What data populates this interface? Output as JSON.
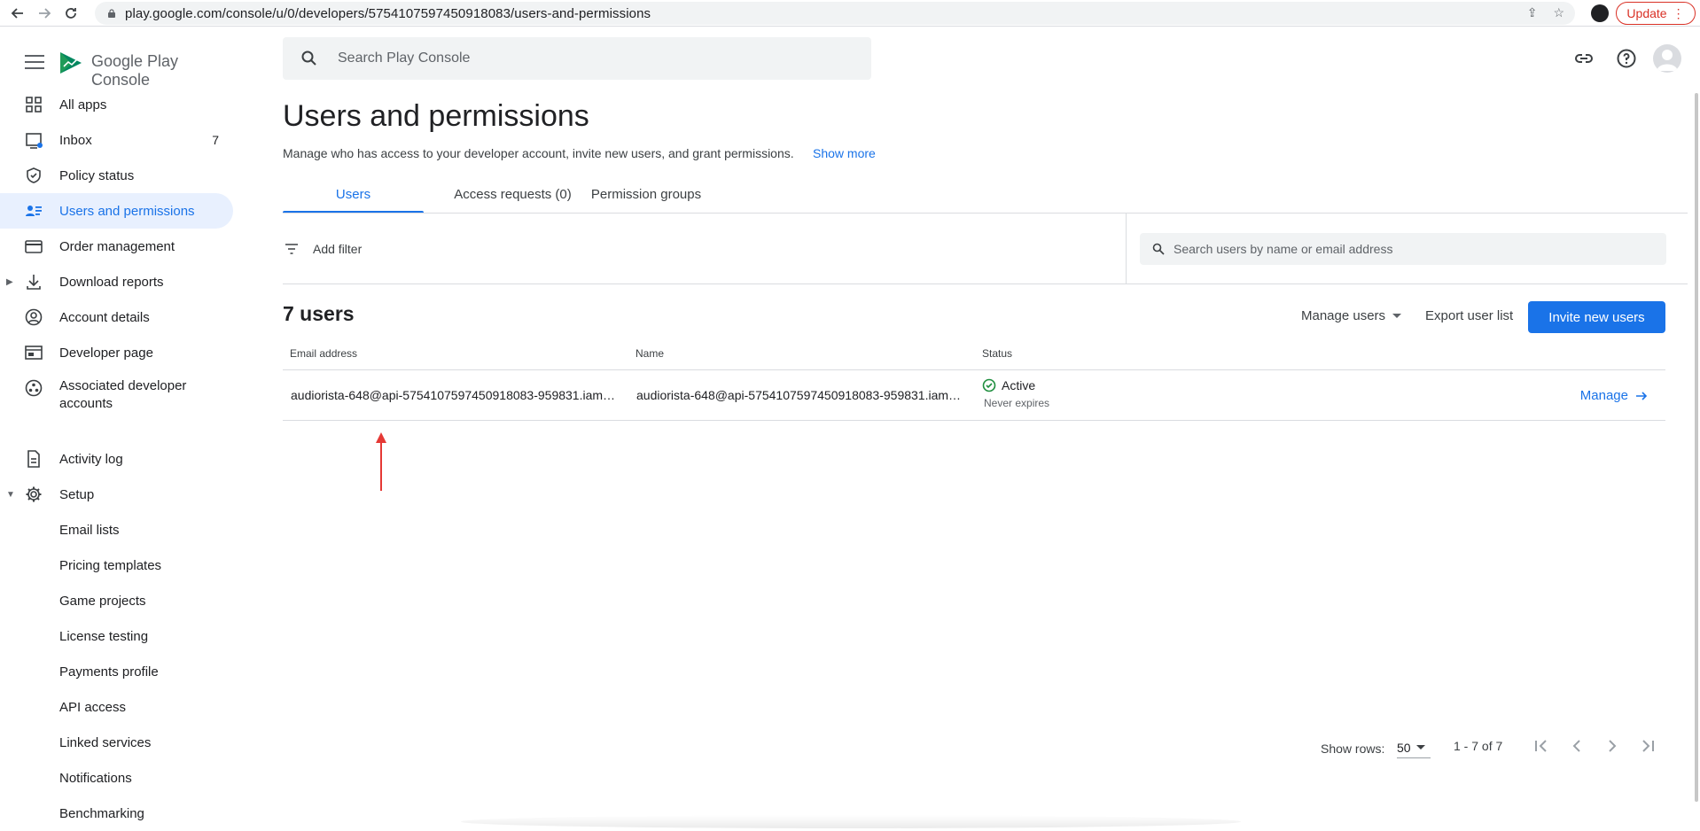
{
  "browser": {
    "url": "play.google.com/console/u/0/developers/5754107597450918083/users-and-permissions",
    "update_label": "Update"
  },
  "app": {
    "logo_text": "Google Play Console",
    "search_placeholder": "Search Play Console"
  },
  "sidebar": {
    "items": [
      {
        "label": "All apps",
        "icon": "grid-icon"
      },
      {
        "label": "Inbox",
        "icon": "inbox-icon",
        "badge": "7"
      },
      {
        "label": "Policy status",
        "icon": "shield-icon"
      },
      {
        "label": "Users and permissions",
        "icon": "people-list-icon"
      },
      {
        "label": "Order management",
        "icon": "credit-card-icon"
      },
      {
        "label": "Download reports",
        "icon": "download-icon"
      },
      {
        "label": "Account details",
        "icon": "account-circle-icon"
      },
      {
        "label": "Developer page",
        "icon": "web-page-icon"
      },
      {
        "label": "Associated developer",
        "label2": "accounts",
        "icon": "associated-icon"
      },
      {
        "label": "Activity log",
        "icon": "document-icon"
      },
      {
        "label": "Setup",
        "icon": "gear-icon"
      }
    ],
    "setup_items": [
      "Email lists",
      "Pricing templates",
      "Game projects",
      "License testing",
      "Payments profile",
      "API access",
      "Linked services",
      "Notifications",
      "Benchmarking"
    ]
  },
  "main": {
    "title": "Users and permissions",
    "description": "Manage who has access to your developer account, invite new users, and grant permissions.",
    "show_more": "Show more",
    "tabs": [
      {
        "label": "Users"
      },
      {
        "label": "Access requests (0)"
      },
      {
        "label": "Permission groups"
      }
    ],
    "add_filter": "Add filter",
    "user_search_placeholder": "Search users by name or email address",
    "users_count": "7 users",
    "manage_users": "Manage users",
    "export_user_list": "Export user list",
    "invite_new_users": "Invite new users",
    "table": {
      "headers": {
        "email": "Email address",
        "name": "Name",
        "status": "Status"
      },
      "rows": [
        {
          "email": "audiorista-648@api-5754107597450918083-959831.iam…",
          "name": "audiorista-648@api-5754107597450918083-959831.iam…",
          "status": "Active",
          "status_sub": "Never expires",
          "action": "Manage"
        }
      ]
    },
    "pagination": {
      "show_rows_label": "Show rows:",
      "rows_value": "50",
      "range": "1 - 7 of 7"
    }
  },
  "colors": {
    "accent": "#1a73e8",
    "active_nav_bg": "#e8f0fe",
    "status_green": "#1e8e3e",
    "annotation_red": "#e53935"
  }
}
